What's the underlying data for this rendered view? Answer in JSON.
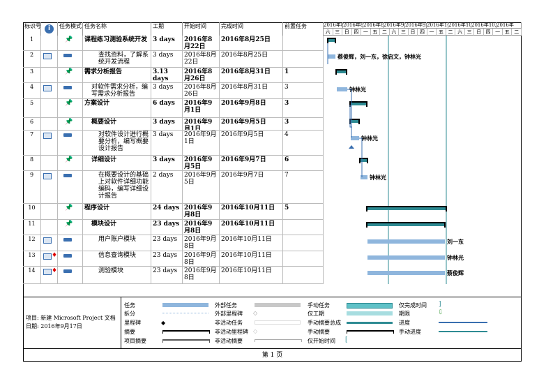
{
  "headers": {
    "id": "标识号",
    "info": "ⓘ",
    "mode": "任务模式",
    "name": "任务名称",
    "duration": "工期",
    "start": "开始时间",
    "finish": "完成时间",
    "pred": "前置任务"
  },
  "timescale_top": [
    "2016年8月1(",
    "2016年8月2(",
    "2016年8月2(",
    "2016年9月1(",
    "2016年9月2(",
    "2016年10月(",
    "2016年10月(",
    "2016年10月2(",
    "2016年"
  ],
  "timescale_days": [
    "六",
    "三",
    "日",
    "四",
    "一",
    "五",
    "二",
    "六",
    "三",
    "日",
    "四",
    "一",
    "五",
    "二",
    "六",
    "三",
    "日",
    "四",
    "一",
    "五",
    "二"
  ],
  "rows": [
    {
      "id": "1",
      "name": "课程练习测验系统开发",
      "duration": "3 days",
      "start": "2016年8月22日",
      "finish": "2016年8月25日",
      "pred": "",
      "bold": true,
      "indent": 0,
      "resource": ""
    },
    {
      "id": "2",
      "name": "查找资料，了解系统开发流程",
      "duration": "3 days",
      "start": "2016年8月22日",
      "finish": "2016年8月25日",
      "pred": "",
      "bold": false,
      "indent": 2,
      "resource": "蔡俊辉，刘一东，徐启文，钟林光"
    },
    {
      "id": "3",
      "name": "需求分析报告",
      "duration": "3.13 days",
      "start": "2016年8月26日",
      "finish": "2016年8月31日",
      "pred": "1",
      "bold": true,
      "indent": 0,
      "resource": ""
    },
    {
      "id": "4",
      "name": "对软件需求分析，编写需求分析报告",
      "duration": "3 days",
      "start": "2016年8月26日",
      "finish": "2016年8月31日",
      "pred": "3",
      "bold": false,
      "indent": 1,
      "resource": "钟林光"
    },
    {
      "id": "5",
      "name": "方案设计",
      "duration": "6 days",
      "start": "2016年9月1日",
      "finish": "2016年9月8日",
      "pred": "3",
      "bold": true,
      "indent": 0,
      "resource": ""
    },
    {
      "id": "6",
      "name": "概要设计",
      "duration": "3 days",
      "start": "2016年9月1日",
      "finish": "2016年9月5日",
      "pred": "3",
      "bold": true,
      "indent": 1,
      "resource": ""
    },
    {
      "id": "7",
      "name": "对软件设计进行概要分析，编写概要设计报告",
      "duration": "3 days",
      "start": "2016年9月1日",
      "finish": "2016年9月5日",
      "pred": "4",
      "bold": false,
      "indent": 2,
      "resource": "钟林光"
    },
    {
      "id": "8",
      "name": "详细设计",
      "duration": "3 days",
      "start": "2016年9月5日",
      "finish": "2016年9月7日",
      "pred": "6",
      "bold": true,
      "indent": 1,
      "resource": ""
    },
    {
      "id": "9",
      "name": "在概要设计的基础上对软件详细功能编码，编写详细设计报告",
      "duration": "2 days",
      "start": "2016年9月5日",
      "finish": "2016年9月7日",
      "pred": "7",
      "bold": false,
      "indent": 2,
      "resource": "钟林光"
    },
    {
      "id": "10",
      "name": "程序设计",
      "duration": "24 days",
      "start": "2016年9月8日",
      "finish": "2016年10月11日",
      "pred": "5",
      "bold": true,
      "indent": 0,
      "resource": ""
    },
    {
      "id": "11",
      "name": "模块设计",
      "duration": "23 days",
      "start": "2016年9月8日",
      "finish": "2016年10月11日",
      "pred": "",
      "bold": true,
      "indent": 1,
      "resource": ""
    },
    {
      "id": "12",
      "name": "用户账户模块",
      "duration": "23 days",
      "start": "2016年9月8日",
      "finish": "2016年10月11日",
      "pred": "",
      "bold": false,
      "indent": 2,
      "resource": "刘一东"
    },
    {
      "id": "13",
      "name": "信息查询模块",
      "duration": "23 days",
      "start": "2016年9月8日",
      "finish": "2016年10月11日",
      "pred": "",
      "bold": false,
      "indent": 2,
      "resource": "钟林光"
    },
    {
      "id": "14",
      "name": "测验模块",
      "duration": "23 days",
      "start": "2016年9月8日",
      "finish": "2016年10月11日",
      "pred": "",
      "bold": false,
      "indent": 2,
      "resource": "蔡俊辉"
    }
  ],
  "legend": {
    "project_label": "项目: 新建 Microsoft Project 文档",
    "date_label": "日期: 2016年9月17日",
    "items": [
      "任务",
      "拆分",
      "里程碑",
      "摘要",
      "项目摘要",
      "外部任务",
      "外部里程碑",
      "非活动任务",
      "非活动里程碑",
      "非活动摘要",
      "手动任务",
      "仅工期",
      "手动摘要总成",
      "手动摘要",
      "仅开始时间",
      "仅完成时间",
      "期限",
      "进度",
      "手动进度"
    ]
  },
  "footer": {
    "page": "第 1 页"
  }
}
